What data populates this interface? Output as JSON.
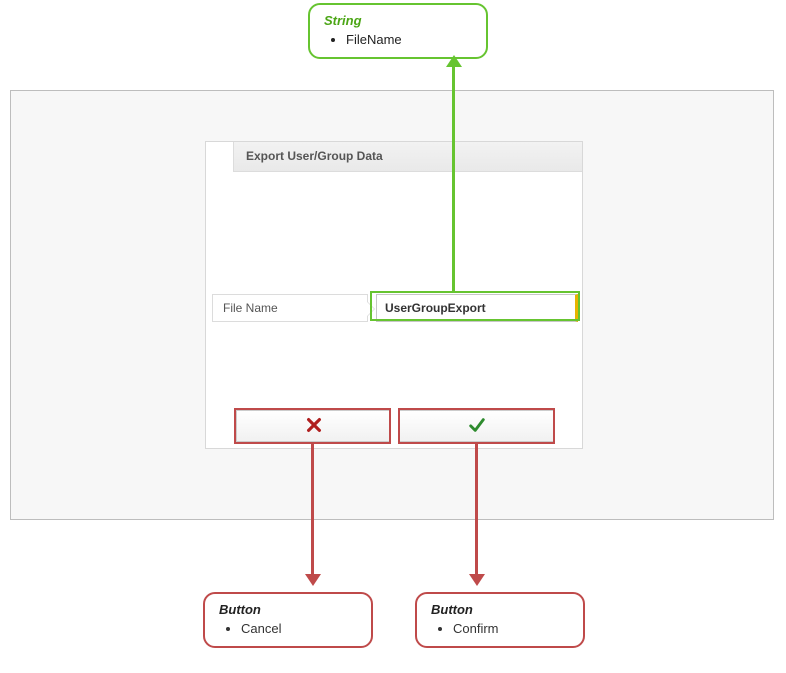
{
  "callouts": {
    "string": {
      "type": "String",
      "item": "FileName"
    },
    "cancel": {
      "type": "Button",
      "item": "Cancel"
    },
    "confirm": {
      "type": "Button",
      "item": "Confirm"
    }
  },
  "dialog": {
    "title": "Export User/Group Data",
    "field_label": "File Name",
    "field_value": "UserGroupExport"
  }
}
